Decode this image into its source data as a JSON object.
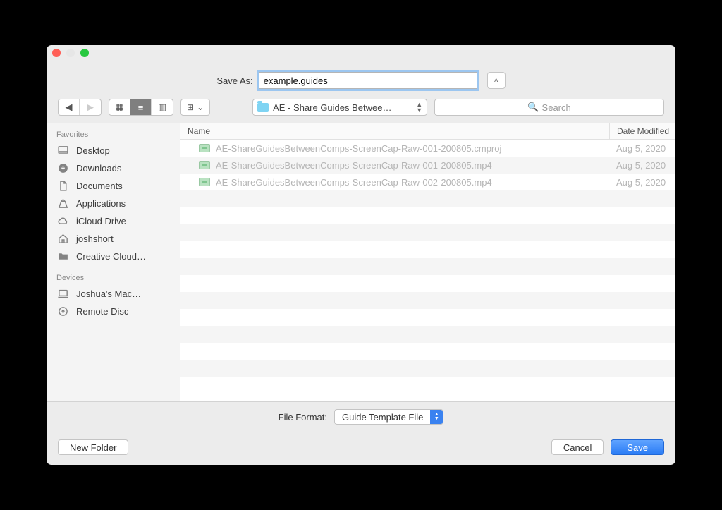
{
  "titlebar": {
    "close": "#ff5f57",
    "minimize": "#e6e6e6",
    "zoom": "#28c840"
  },
  "saveas": {
    "label": "Save As:",
    "value": "example.guides"
  },
  "toolbar": {
    "folder_label": "AE - Share Guides Betwee…",
    "search_placeholder": "Search"
  },
  "sidebar": {
    "favorites_title": "Favorites",
    "devices_title": "Devices",
    "favorites": [
      {
        "key": "desktop",
        "label": "Desktop"
      },
      {
        "key": "downloads",
        "label": "Downloads"
      },
      {
        "key": "documents",
        "label": "Documents"
      },
      {
        "key": "applications",
        "label": "Applications"
      },
      {
        "key": "icloud",
        "label": "iCloud Drive"
      },
      {
        "key": "home",
        "label": "joshshort"
      },
      {
        "key": "ccloud",
        "label": "Creative Cloud…"
      }
    ],
    "devices": [
      {
        "key": "mac",
        "label": "Joshua's Mac…"
      },
      {
        "key": "disc",
        "label": "Remote Disc"
      }
    ]
  },
  "columns": {
    "name": "Name",
    "date": "Date Modified"
  },
  "files": [
    {
      "name": "AE-ShareGuidesBetweenComps-ScreenCap-Raw-001-200805.cmproj",
      "date": "Aug 5, 2020"
    },
    {
      "name": "AE-ShareGuidesBetweenComps-ScreenCap-Raw-001-200805.mp4",
      "date": "Aug 5, 2020"
    },
    {
      "name": "AE-ShareGuidesBetweenComps-ScreenCap-Raw-002-200805.mp4",
      "date": "Aug 5, 2020"
    }
  ],
  "format": {
    "label": "File Format:",
    "value": "Guide Template File"
  },
  "buttons": {
    "new_folder": "New Folder",
    "cancel": "Cancel",
    "save": "Save"
  }
}
